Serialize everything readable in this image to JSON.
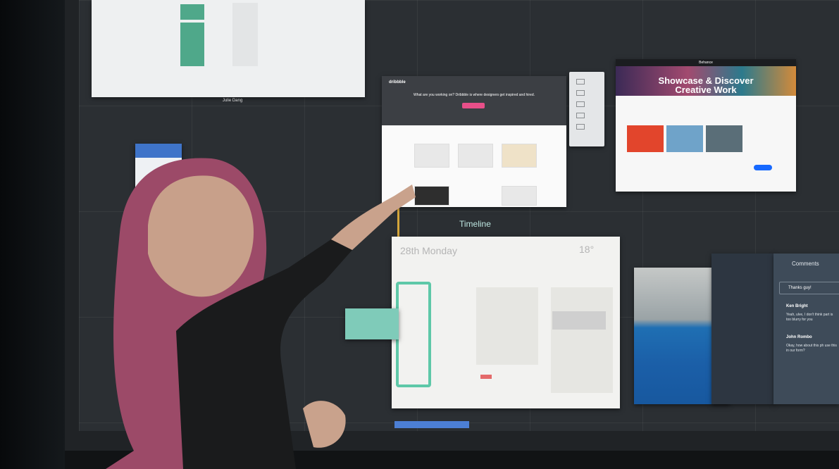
{
  "scene": "person-at-touch-display",
  "top_left_tile": {
    "owner_label": "Julie Dang"
  },
  "dribbble": {
    "logo": "dribbble",
    "headline": "What are you working on? Dribbble is where designers get inspired and hired."
  },
  "behance": {
    "brand": "Behance",
    "hero_title_line1": "Showcase & Discover",
    "hero_title_line2": "Creative Work"
  },
  "timeline": {
    "label": "Timeline",
    "date": "28th Monday",
    "temperature": "18°"
  },
  "comments": {
    "title": "Comments",
    "input_value": "Thanks guy!",
    "items": [
      {
        "author": "Ken Bright",
        "text": "Yeah, ulve, I don't think part is too blurry for you"
      },
      {
        "author": "John Rombo",
        "text": "Okay, how about this ph use this in our form?"
      }
    ]
  },
  "colors": {
    "accent_teal": "#5ec8a8",
    "behance_blue": "#1769ff",
    "dribbble_pink": "#e84f89"
  }
}
